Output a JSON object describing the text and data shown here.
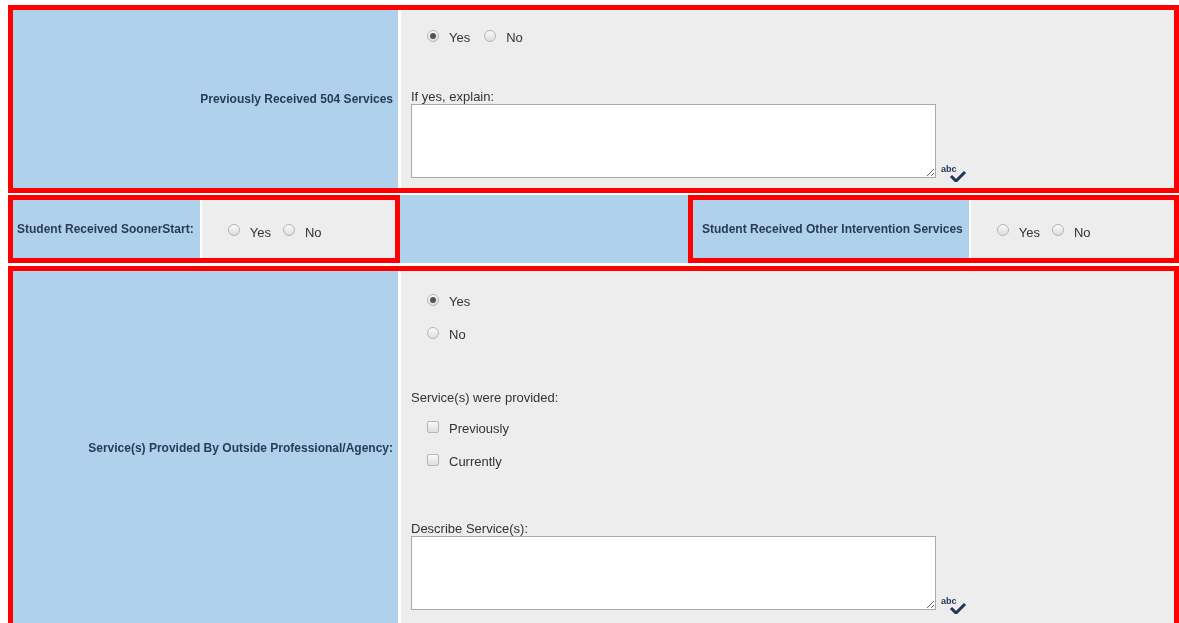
{
  "previous_504": {
    "highlighted": true,
    "label": "Previously Received 504 Services",
    "options": [
      {
        "label": "Yes",
        "selected": true
      },
      {
        "label": "No",
        "selected": false
      }
    ],
    "field_label": "If yes, explain:",
    "spellcheck": "abc"
  },
  "inline_questions": [
    {
      "highlighted": true,
      "label": "Student Received SoonerStart:",
      "options": [
        {
          "label": "Yes",
          "selected": false
        },
        {
          "label": "No",
          "selected": false
        }
      ]
    },
    {
      "highlighted": true,
      "label": "Student Received Other Intervention Services",
      "options": [
        {
          "label": "Yes",
          "selected": false
        },
        {
          "label": "No",
          "selected": false
        }
      ]
    }
  ],
  "outside_services": {
    "highlighted": true,
    "label": "Service(s) Provided By Outside Professional/Agency:",
    "options": [
      {
        "label": "Yes",
        "selected": true
      },
      {
        "label": "No",
        "selected": false
      }
    ],
    "provided_label": "Service(s) were provided:",
    "provided": [
      {
        "label": "Previously",
        "checked": false
      },
      {
        "label": "Currently",
        "checked": false
      }
    ],
    "field_label": "Describe Service(s):",
    "spellcheck": "abc"
  }
}
